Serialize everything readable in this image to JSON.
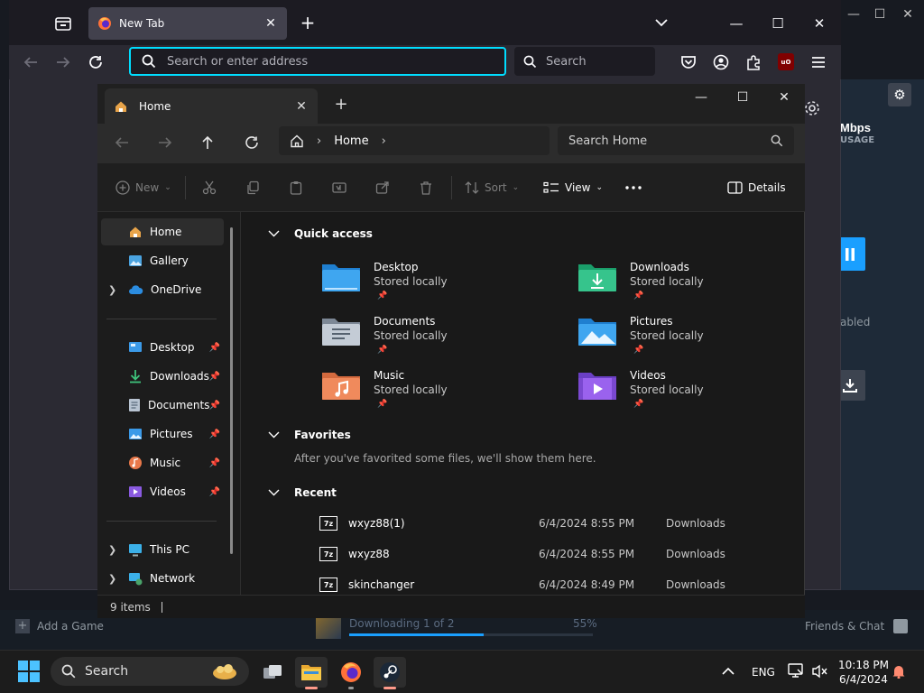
{
  "steam": {
    "stat_value": "Mbps",
    "stat_label": "USAGE",
    "side_text": "abled",
    "add_game": "Add a Game",
    "download_status": "Downloading 1 of 2",
    "download_percent": "55%",
    "download_progress": 0.55,
    "friends_chat": "Friends & Chat"
  },
  "firefox": {
    "tab_title": "New Tab",
    "url_placeholder": "Search or enter address",
    "search_label": "Search",
    "ublock_label": "uO"
  },
  "explorer": {
    "tab_title": "Home",
    "breadcrumb": "Home",
    "search_placeholder": "Search Home",
    "toolbar": {
      "new": "New",
      "sort": "Sort",
      "view": "View",
      "details": "Details"
    },
    "sidebar": {
      "top": [
        {
          "label": "Home"
        },
        {
          "label": "Gallery"
        },
        {
          "label": "OneDrive"
        }
      ],
      "pinned": [
        {
          "label": "Desktop"
        },
        {
          "label": "Downloads"
        },
        {
          "label": "Documents"
        },
        {
          "label": "Pictures"
        },
        {
          "label": "Music"
        },
        {
          "label": "Videos"
        }
      ],
      "bottom": [
        {
          "label": "This PC"
        },
        {
          "label": "Network"
        }
      ]
    },
    "sections": {
      "quick_access": "Quick access",
      "favorites": "Favorites",
      "recent": "Recent"
    },
    "quick_access": [
      {
        "name": "Desktop",
        "status": "Stored locally"
      },
      {
        "name": "Downloads",
        "status": "Stored locally"
      },
      {
        "name": "Documents",
        "status": "Stored locally"
      },
      {
        "name": "Pictures",
        "status": "Stored locally"
      },
      {
        "name": "Music",
        "status": "Stored locally"
      },
      {
        "name": "Videos",
        "status": "Stored locally"
      }
    ],
    "favorites_empty": "After you've favorited some files, we'll show them here.",
    "recent": [
      {
        "name": "wxyz88(1)",
        "date": "6/4/2024 8:55 PM",
        "location": "Downloads",
        "icon": "7z"
      },
      {
        "name": "wxyz88",
        "date": "6/4/2024 8:55 PM",
        "location": "Downloads",
        "icon": "7z"
      },
      {
        "name": "skinchanger",
        "date": "6/4/2024 8:49 PM",
        "location": "Downloads",
        "icon": "7z"
      }
    ],
    "status": "9 items"
  },
  "taskbar": {
    "search_label": "Search",
    "language": "ENG",
    "time": "10:18 PM",
    "date": "6/4/2024"
  }
}
